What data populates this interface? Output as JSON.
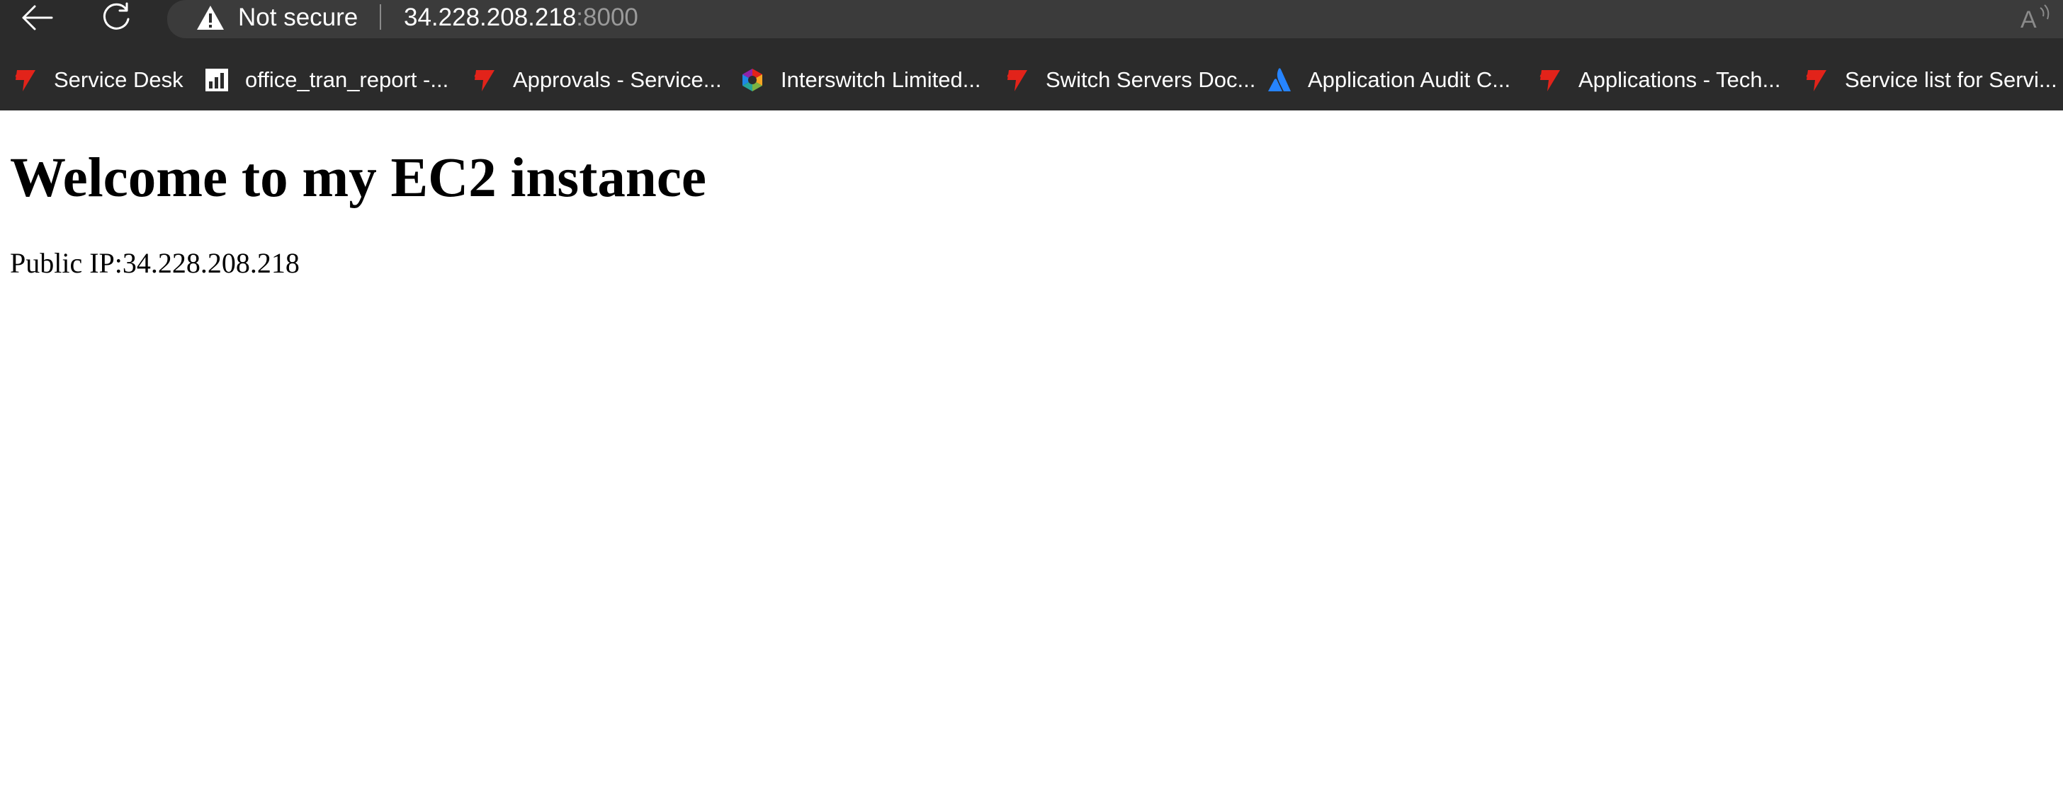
{
  "browser": {
    "security_label": "Not secure",
    "url_host": "34.228.208.218",
    "url_port": ":8000",
    "bookmarks": [
      {
        "label": "Service Desk",
        "icon": "interswitch-logo-icon"
      },
      {
        "label": "office_tran_report -...",
        "icon": "report-chart-icon"
      },
      {
        "label": "Approvals - Service...",
        "icon": "interswitch-logo-icon"
      },
      {
        "label": "Interswitch Limited...",
        "icon": "colorful-hexagon-icon"
      },
      {
        "label": "Switch Servers Doc...",
        "icon": "interswitch-logo-icon"
      },
      {
        "label": "Application Audit C...",
        "icon": "atlassian-logo-icon"
      },
      {
        "label": "Applications - Tech...",
        "icon": "interswitch-logo-icon"
      },
      {
        "label": "Service list for Servi...",
        "icon": "interswitch-logo-icon"
      }
    ],
    "colors": {
      "chrome_bg": "#2b2b2b",
      "address_bg": "#3b3b3b",
      "interswitch_red": "#e2231a",
      "atlassian_blue": "#2684ff"
    }
  },
  "page": {
    "title": "Welcome to my EC2 instance",
    "ip_line": "Public IP:34.228.208.218"
  }
}
